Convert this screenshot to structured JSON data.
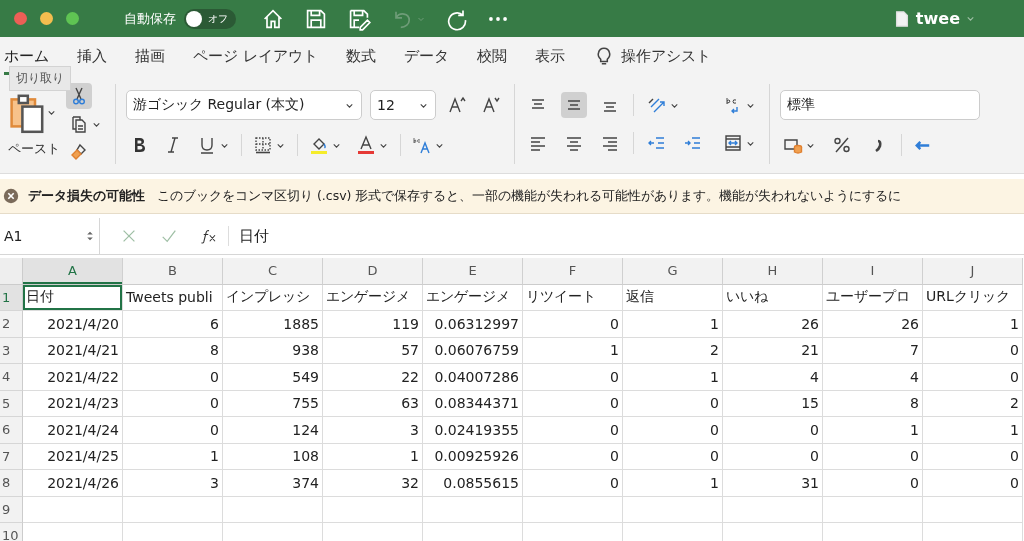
{
  "title_bar": {
    "autosave_label": "自動保存",
    "autosave": {
      "label": "オフ",
      "on": false
    },
    "document_title": "twee"
  },
  "ribbon_tabs": [
    {
      "label": "ホーム",
      "selected": true
    },
    {
      "label": "挿入",
      "selected": false
    },
    {
      "label": "描画",
      "selected": false
    },
    {
      "label": "ページ レイアウト",
      "selected": false
    },
    {
      "label": "数式",
      "selected": false
    },
    {
      "label": "データ",
      "selected": false
    },
    {
      "label": "校閲",
      "selected": false
    },
    {
      "label": "表示",
      "selected": false
    }
  ],
  "tell_me": "操作アシスト",
  "tooltip": "切り取り",
  "ribbon": {
    "paste_label": "ペースト",
    "cut_highlighted": true,
    "font_name": "游ゴシック Regular (本文)",
    "font_size": "12",
    "number_format": "標準",
    "vertical_align": [
      {
        "selected": false
      },
      {
        "selected": true
      },
      {
        "selected": false
      }
    ]
  },
  "message_bar": {
    "title": "データ損失の可能性",
    "text": "このブックをコンマ区切り (.csv) 形式で保存すると、一部の機能が失われる可能性があります。機能が失われないようにするに"
  },
  "formula_bar": {
    "cell_ref": "A1",
    "formula": "日付"
  },
  "sheet": {
    "columns": [
      {
        "label": "A",
        "selected": true
      },
      {
        "label": "B",
        "selected": false
      },
      {
        "label": "C",
        "selected": false
      },
      {
        "label": "D",
        "selected": false
      },
      {
        "label": "E",
        "selected": false
      },
      {
        "label": "F",
        "selected": false
      },
      {
        "label": "G",
        "selected": false
      },
      {
        "label": "H",
        "selected": false
      },
      {
        "label": "I",
        "selected": false
      },
      {
        "label": "J",
        "selected": false
      }
    ],
    "rows": [
      {
        "number": "1",
        "kind": "header",
        "selected": true,
        "cells": [
          "日付",
          "Tweets publi",
          "インプレッシ",
          "エンゲージメ",
          "エンゲージメ",
          "リツイート",
          "返信",
          "いいね",
          "ユーザープロ",
          "URLクリック"
        ]
      },
      {
        "number": "2",
        "kind": "data",
        "selected": false,
        "cells": [
          "2021/4/20",
          "6",
          "1885",
          "119",
          "0.06312997",
          "0",
          "1",
          "26",
          "26",
          "1"
        ]
      },
      {
        "number": "3",
        "kind": "data",
        "selected": false,
        "cells": [
          "2021/4/21",
          "8",
          "938",
          "57",
          "0.06076759",
          "1",
          "2",
          "21",
          "7",
          "0"
        ]
      },
      {
        "number": "4",
        "kind": "data",
        "selected": false,
        "cells": [
          "2021/4/22",
          "0",
          "549",
          "22",
          "0.04007286",
          "0",
          "1",
          "4",
          "4",
          "0"
        ]
      },
      {
        "number": "5",
        "kind": "data",
        "selected": false,
        "cells": [
          "2021/4/23",
          "0",
          "755",
          "63",
          "0.08344371",
          "0",
          "0",
          "15",
          "8",
          "2"
        ]
      },
      {
        "number": "6",
        "kind": "data",
        "selected": false,
        "cells": [
          "2021/4/24",
          "0",
          "124",
          "3",
          "0.02419355",
          "0",
          "0",
          "0",
          "1",
          "1"
        ]
      },
      {
        "number": "7",
        "kind": "data",
        "selected": false,
        "cells": [
          "2021/4/25",
          "1",
          "108",
          "1",
          "0.00925926",
          "0",
          "0",
          "0",
          "0",
          "0"
        ]
      },
      {
        "number": "8",
        "kind": "data",
        "selected": false,
        "cells": [
          "2021/4/26",
          "3",
          "374",
          "32",
          "0.0855615",
          "0",
          "1",
          "31",
          "0",
          "0"
        ]
      },
      {
        "number": "9",
        "kind": "empty",
        "selected": false
      },
      {
        "number": "10",
        "kind": "empty",
        "selected": false
      }
    ]
  }
}
